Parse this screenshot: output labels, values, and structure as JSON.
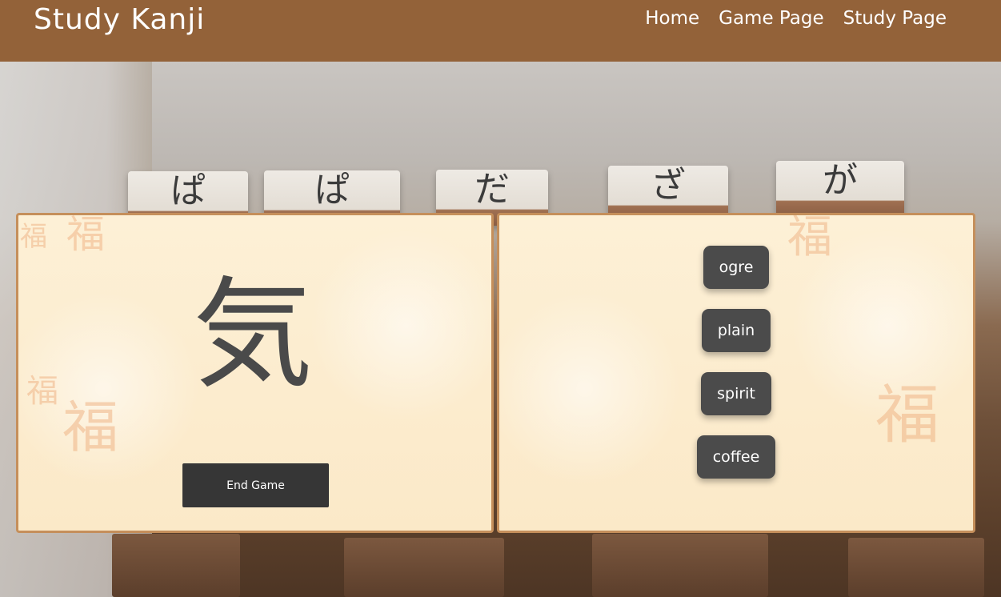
{
  "header": {
    "brand": "Study Kanji",
    "nav": [
      {
        "label": "Home"
      },
      {
        "label": "Game Page"
      },
      {
        "label": "Study Page"
      }
    ]
  },
  "game": {
    "kanji": "気",
    "end_label": "End Game",
    "choices": [
      {
        "label": "ogre"
      },
      {
        "label": "plain"
      },
      {
        "label": "spirit"
      },
      {
        "label": "coffee"
      }
    ]
  },
  "background_tiles": [
    "ぱ",
    "ぱ",
    "だ",
    "ざ",
    "が"
  ],
  "card_decoration": [
    "福",
    "福",
    "福",
    "福",
    "福",
    "福"
  ],
  "colors": {
    "header": "#936239",
    "card_border": "#c58f5b",
    "button": "#363636",
    "choice": "#4b4b4b"
  }
}
